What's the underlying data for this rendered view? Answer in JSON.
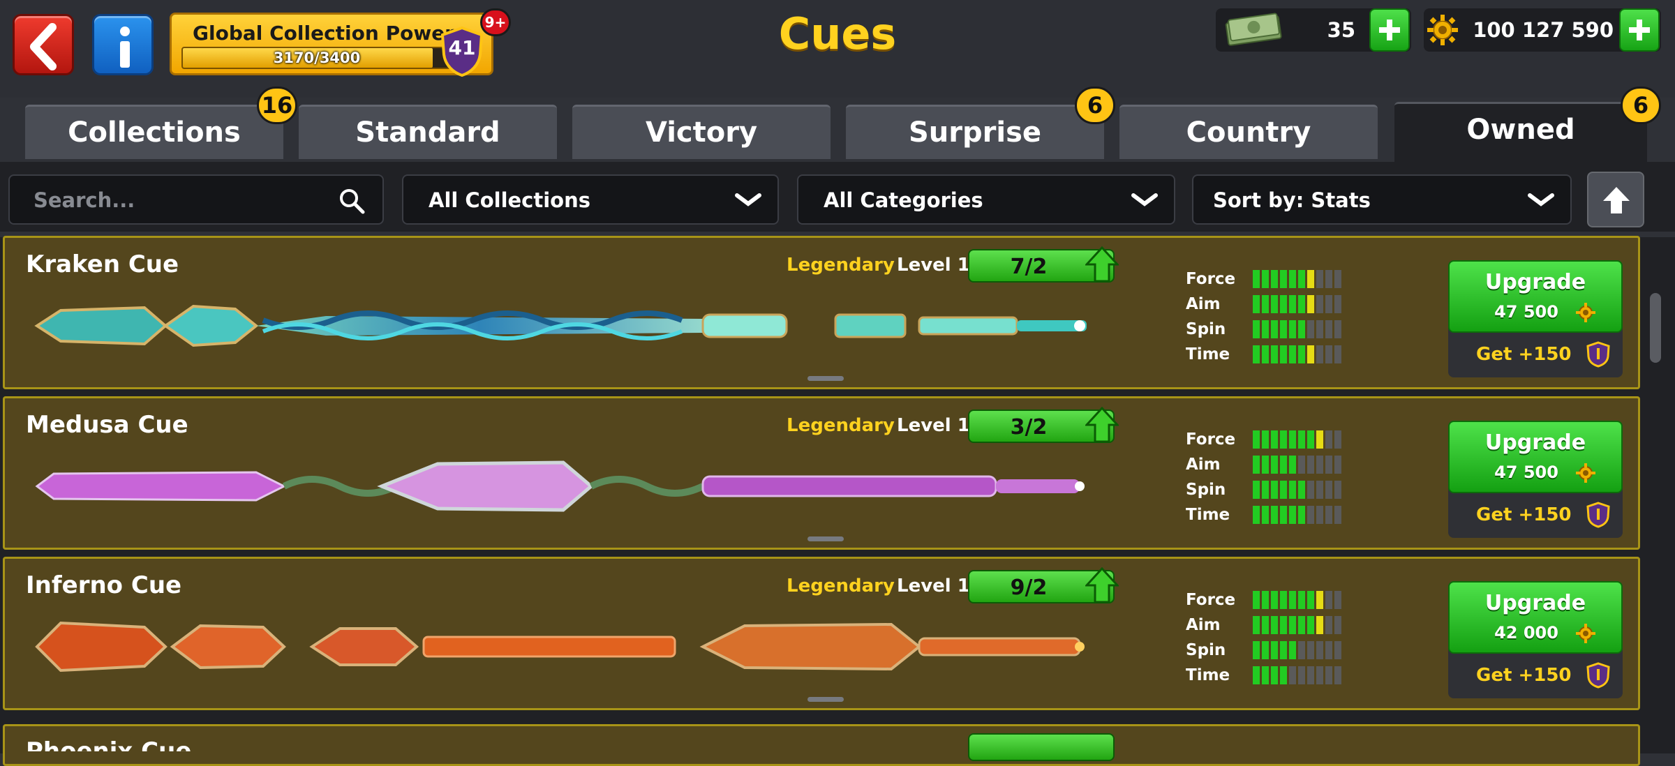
{
  "header": {
    "title": "Cues",
    "collection_power": {
      "label": "Global Collection Power",
      "progress_text": "3170/3400",
      "progress_fraction": 0.932,
      "level": "41",
      "notification": "9+"
    },
    "cash": {
      "value": "35"
    },
    "coins": {
      "value": "100 127 590"
    }
  },
  "tabs": [
    {
      "label": "Collections",
      "badge": "16"
    },
    {
      "label": "Standard",
      "badge": ""
    },
    {
      "label": "Victory",
      "badge": ""
    },
    {
      "label": "Surprise",
      "badge": "6"
    },
    {
      "label": "Country",
      "badge": ""
    },
    {
      "label": "Owned",
      "badge": "6",
      "active": true
    }
  ],
  "filters": {
    "search_placeholder": "Search...",
    "collection": "All Collections",
    "category": "All Categories",
    "sort": "Sort by: Stats"
  },
  "stat_labels": [
    "Force",
    "Aim",
    "Spin",
    "Time"
  ],
  "cues": [
    {
      "name": "Kraken Cue",
      "rarity": "Legendary",
      "level": "Level 1",
      "progress": "7/2",
      "stats": {
        "force": 7,
        "aim": 7,
        "spin": 6,
        "time": 7
      },
      "upgrade_label": "Upgrade",
      "price": "47 500",
      "get": "Get +150"
    },
    {
      "name": "Medusa Cue",
      "rarity": "Legendary",
      "level": "Level 1",
      "progress": "3/2",
      "stats": {
        "force": 8,
        "aim": 5,
        "spin": 6,
        "time": 6
      },
      "upgrade_label": "Upgrade",
      "price": "47 500",
      "get": "Get +150"
    },
    {
      "name": "Inferno Cue",
      "rarity": "Legendary",
      "level": "Level 1",
      "progress": "9/2",
      "stats": {
        "force": 8,
        "aim": 8,
        "spin": 5,
        "time": 4
      },
      "upgrade_label": "Upgrade",
      "price": "42 000",
      "get": "Get +150"
    },
    {
      "name": "Phoenix Cue",
      "partial": true
    }
  ],
  "colors": {
    "accent": "#ffd21f",
    "button_green": "#22a512",
    "card_bg": "#54461d",
    "card_border": "#a89417",
    "stat_green": "#22cc22",
    "stat_yellow": "#e6dc14"
  }
}
